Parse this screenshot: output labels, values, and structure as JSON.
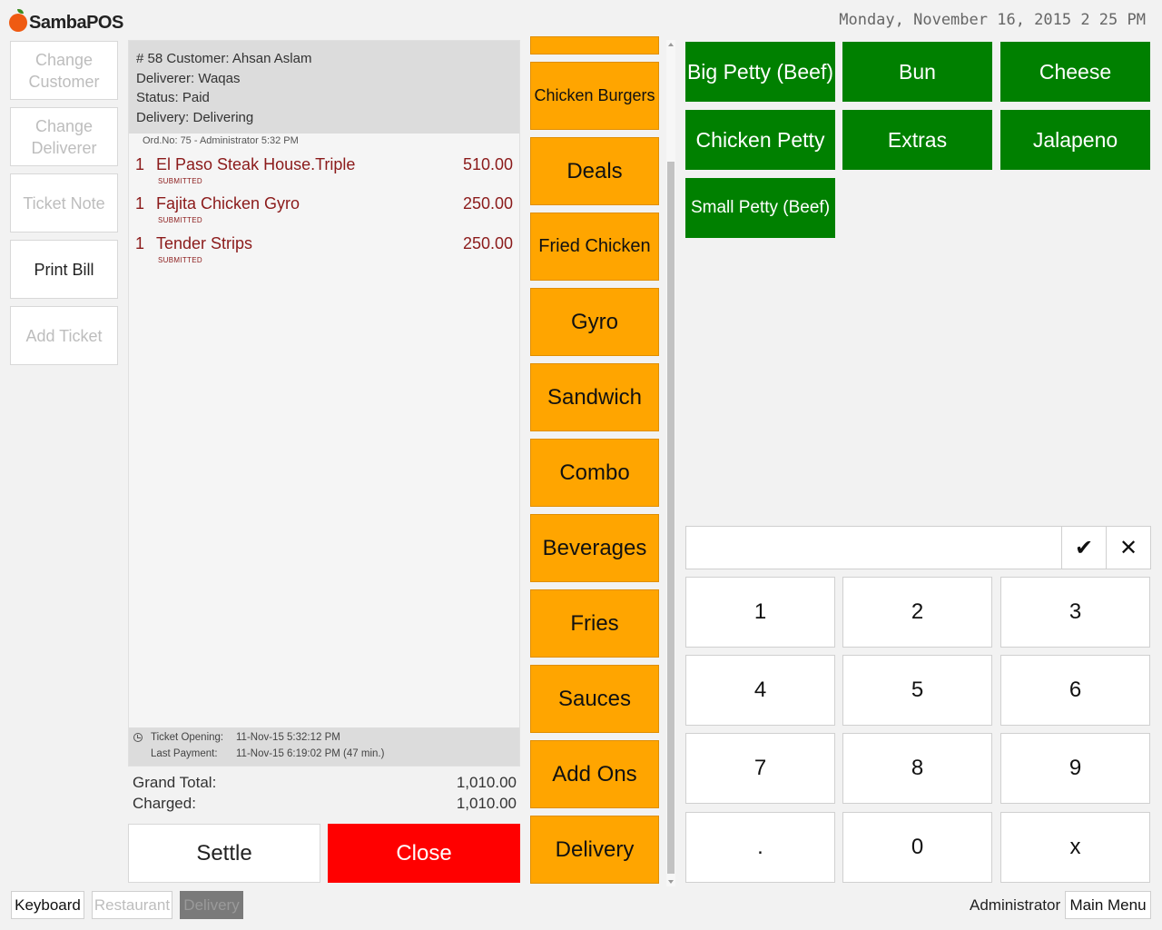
{
  "app": {
    "logo_text": "SambaPOS",
    "datetime": "Monday, November 16, 2015 2 25 PM"
  },
  "left_actions": [
    {
      "label": "Change Customer"
    },
    {
      "label": "Change Deliverer"
    },
    {
      "label": "Ticket Note"
    },
    {
      "label": "Print Bill"
    },
    {
      "label": "Add Ticket"
    }
  ],
  "ticket": {
    "header": {
      "line1": "# 58 Customer: Ahsan Aslam",
      "line2": "Deliverer: Waqas",
      "line3": "Status: Paid",
      "line4": "Delivery: Delivering"
    },
    "order_meta": "Ord.No: 75 - Administrator  5:32 PM",
    "orders": [
      {
        "qty": "1",
        "name": "El Paso Steak House.Triple",
        "price": "510.00",
        "status": "SUBMITTED"
      },
      {
        "qty": "1",
        "name": "Fajita Chicken Gyro",
        "price": "250.00",
        "status": "SUBMITTED"
      },
      {
        "qty": "1",
        "name": "Tender Strips",
        "price": "250.00",
        "status": "SUBMITTED"
      }
    ],
    "footer": {
      "opening_label": "Ticket Opening:",
      "opening_value": "11-Nov-15 5:32:12 PM",
      "payment_label": "Last Payment:",
      "payment_value": "11-Nov-15 6:19:02 PM (47 min.)"
    },
    "totals": {
      "grand_total_label": "Grand Total:",
      "grand_total_value": "1,010.00",
      "charged_label": "Charged:",
      "charged_value": "1,010.00"
    },
    "settle_label": "Settle",
    "close_label": "Close"
  },
  "categories": [
    "Chicken Burgers",
    "Deals",
    "Fried Chicken",
    "Gyro",
    "Sandwich",
    "Combo",
    "Beverages",
    "Fries",
    "Sauces",
    "Add Ons",
    "Delivery"
  ],
  "products": [
    "Big Petty (Beef)",
    "Bun",
    "Cheese",
    "Chicken Petty",
    "Extras",
    "Jalapeno",
    "Small Petty (Beef)"
  ],
  "numpad": {
    "ok_glyph": "✔",
    "cancel_glyph": "✕",
    "keys": [
      "1",
      "2",
      "3",
      "4",
      "5",
      "6",
      "7",
      "8",
      "9",
      ".",
      "0",
      "x"
    ]
  },
  "bottom": {
    "keyboard": "Keyboard",
    "restaurant": "Restaurant",
    "delivery": "Delivery",
    "user": "Administrator",
    "main_menu": "Main Menu"
  },
  "colors": {
    "category": "#ffa500",
    "product": "#008000",
    "close": "#ff0000",
    "order_text": "#8b1a1a"
  }
}
